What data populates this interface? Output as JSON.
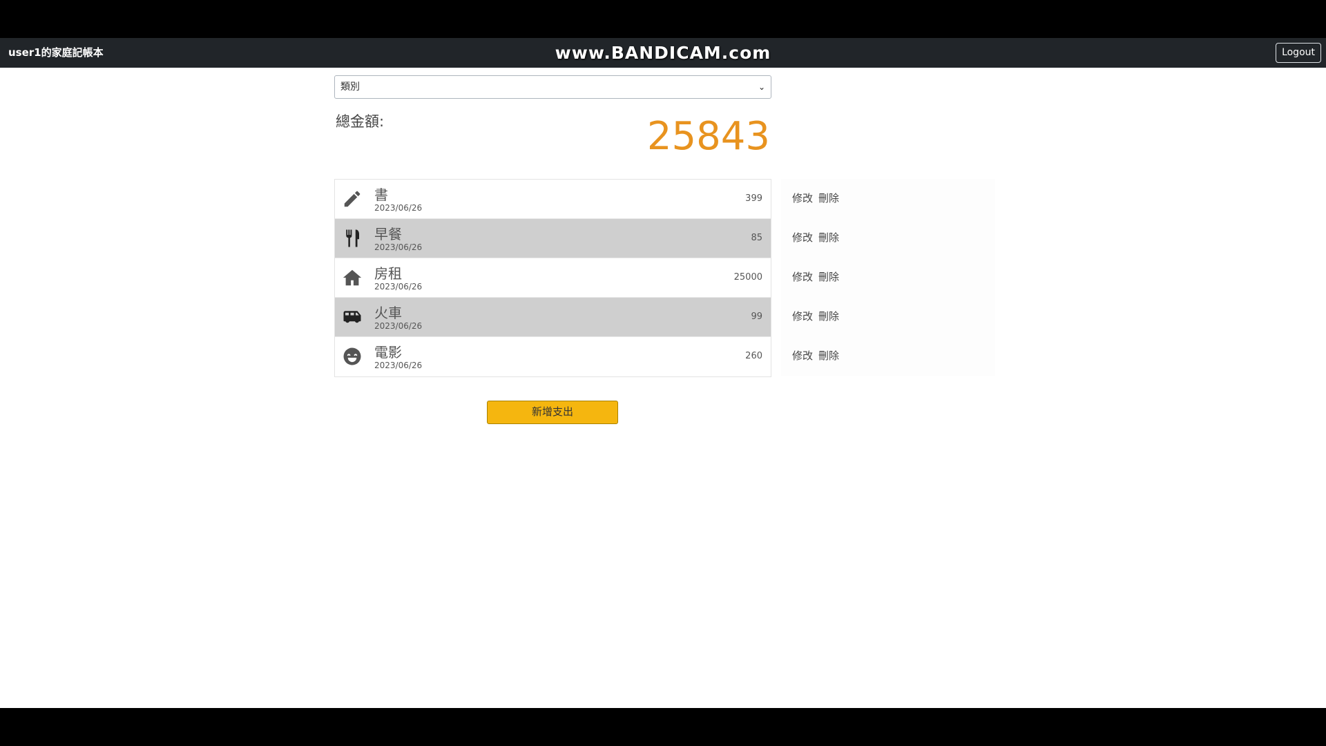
{
  "header": {
    "brand": "user1的家庭記帳本",
    "watermark": "www.BANDICAM.com",
    "logout_label": "Logout"
  },
  "filter": {
    "selected": "類別"
  },
  "total": {
    "label": "總金額:",
    "value": "25843"
  },
  "expenses": [
    {
      "icon": "pencil-icon",
      "name": "書",
      "date": "2023/06/26",
      "amount": "399"
    },
    {
      "icon": "utensils-icon",
      "name": "早餐",
      "date": "2023/06/26",
      "amount": "85"
    },
    {
      "icon": "home-icon",
      "name": "房租",
      "date": "2023/06/26",
      "amount": "25000"
    },
    {
      "icon": "van-icon",
      "name": "火車",
      "date": "2023/06/26",
      "amount": "99"
    },
    {
      "icon": "smile-icon",
      "name": "電影",
      "date": "2023/06/26",
      "amount": "260"
    }
  ],
  "actions": {
    "edit_label": "修改",
    "delete_label": "刪除"
  },
  "add_button_label": "新增支出",
  "colors": {
    "navbar": "#212529",
    "total": "#e8931f",
    "add_button": "#f5b60f",
    "shaded_row": "#cfcfcf"
  }
}
